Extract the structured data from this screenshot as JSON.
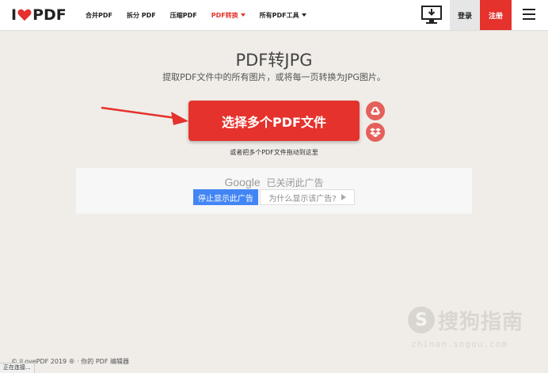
{
  "header": {
    "logo_left": "I",
    "logo_right": "PDF",
    "nav": [
      {
        "label": "合并PDF",
        "active": false,
        "dropdown": false
      },
      {
        "label": "拆分 PDF",
        "active": false,
        "dropdown": false
      },
      {
        "label": "压缩PDF",
        "active": false,
        "dropdown": false
      },
      {
        "label": "PDF转换",
        "active": true,
        "dropdown": true
      },
      {
        "label": "所有PDF工具",
        "active": false,
        "dropdown": true
      }
    ],
    "desktop_icon": "desktop-download-icon",
    "login_label": "登录",
    "signup_label": "注册",
    "menu_icon": "hamburger-menu-icon"
  },
  "main": {
    "title": "PDF转JPG",
    "subtitle": "提取PDF文件中的所有图片，或将每一页转换为JPG图片。",
    "select_button_label": "选择多个PDF文件",
    "drop_hint": "或者把多个PDF文件拖动到这里",
    "drive_icon": "google-drive-icon",
    "dropbox_icon": "dropbox-icon"
  },
  "ad": {
    "brand": "Google",
    "closed_text": "已关闭此广告",
    "stop_label": "停止显示此广告",
    "why_label": "为什么显示该广告?"
  },
  "watermark": {
    "logo_letter": "S",
    "text": "搜狗指南",
    "url": "zhinan.sogou.com"
  },
  "footer": {
    "text": "© iLovePDF 2019 ® · 你的 PDF 编辑器"
  },
  "status_bar": {
    "text": "正在连接..."
  },
  "colors": {
    "brand_red": "#e5322d",
    "background": "#f0ede8",
    "google_blue": "#4285f4"
  }
}
